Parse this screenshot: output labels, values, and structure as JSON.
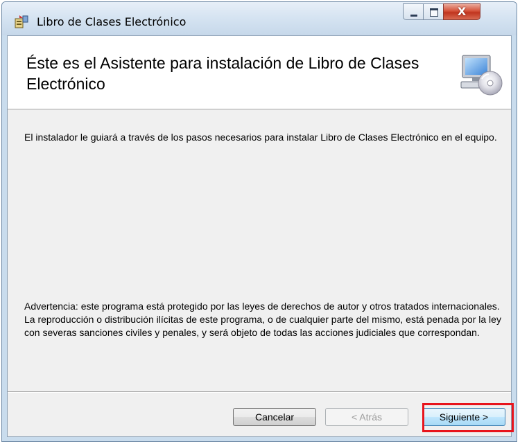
{
  "window": {
    "title": "Libro de Clases Electrónico",
    "close_glyph": "X",
    "icons": {
      "app": "installer-icon",
      "banner": "computer-cd-icon"
    }
  },
  "banner": {
    "title": "Éste es el Asistente para instalación de Libro de Clases Electrónico"
  },
  "body": {
    "intro": "El instalador le guiará a través de los pasos necesarios para instalar Libro de Clases Electrónico en el equipo.",
    "warning": "Advertencia: este programa está protegido por las leyes de derechos de autor y otros tratados internacionales. La reproducción o distribución ilícitas de este programa, o de cualquier parte del mismo, está penada por la ley con severas sanciones civiles y penales, y será objeto de todas las acciones judiciales que correspondan."
  },
  "buttons": {
    "cancel": "Cancelar",
    "back": "< Atrás",
    "next": "Siguiente >"
  },
  "colors": {
    "highlight": "#e8141c",
    "title_bar": "#d6e4f2",
    "close_button": "#c0341e"
  }
}
